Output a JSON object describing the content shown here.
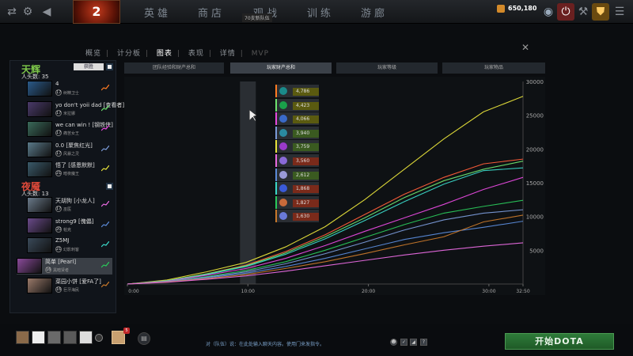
{
  "top": {
    "logo": "2",
    "nav": [
      "英雄",
      "商店",
      "观战",
      "训练",
      "游廊"
    ],
    "team_badge": "70支新队伍",
    "gold": "650,180",
    "icons": [
      "shuffle-icon",
      "gear-icon",
      "back-icon",
      "trophy-icon",
      "streaming-icon",
      "power-icon",
      "tools-icon",
      "shield-icon"
    ]
  },
  "subnav": {
    "items": [
      "概览",
      "计分板",
      "图表",
      "表现",
      "详情",
      "MVP"
    ],
    "active": "图表"
  },
  "close_symbol": "✕",
  "radiant": {
    "title": "天辉",
    "kills_label": "人头数:",
    "kills": "35",
    "win_badge": "获胜",
    "players": [
      {
        "name": "4",
        "hero": "树精卫士",
        "level": "17",
        "color": "#ff7b22",
        "portrait": "#2a5a8a"
      },
      {
        "name": "yo don't yoii dad [查看者]",
        "hero": "米拉娜",
        "level": "17",
        "color": "#6ee36e",
        "portrait": "#4a3a6a"
      },
      {
        "name": "we can win ! [钢铁侠]",
        "hero": "痛苦女王",
        "level": "17",
        "color": "#e84ae0",
        "portrait": "#3a6a5a"
      },
      {
        "name": "0.0 [聚焦红光]",
        "hero": "风暴之灵",
        "level": "17",
        "color": "#7a9ad8",
        "portrait": "#5a7a8a"
      },
      {
        "name": "悟了 [感恩默默]",
        "hero": "暗夜魔王",
        "level": "21",
        "color": "#e7e23a",
        "portrait": "#3a5a6a"
      }
    ]
  },
  "dire": {
    "title": "夜魇",
    "kills_label": "人头数:",
    "kills": "13",
    "players": [
      {
        "name": "天胡狗 [小龙人]",
        "hero": "巫医",
        "level": "17",
        "color": "#e86ae0",
        "portrait": "#6a7a8a"
      },
      {
        "name": "strong9 [傀儡]",
        "hero": "帕克",
        "level": "20",
        "color": "#5a8ad8",
        "portrait": "#6a4a8a"
      },
      {
        "name": "Z5MJ",
        "hero": "幻影刺客",
        "level": "21",
        "color": "#3ad8c8",
        "portrait": "#3a4a5a"
      },
      {
        "name": "简单 [Pearl]",
        "hero": "黑暗贤者",
        "level": "16",
        "color": "#2ac85a",
        "portrait": "#8a4a9a"
      },
      {
        "name": "菜园小饼 [爱FA了]",
        "hero": "巨牙海民",
        "level": "16",
        "color": "#c8782a",
        "portrait": "#9a7a6a"
      }
    ]
  },
  "tabs": [
    "团队经验和财产总和",
    "玩家财产总和",
    "玩家等级",
    "玩家物品"
  ],
  "active_tab": "玩家财产总和",
  "chart_data": {
    "type": "line",
    "x_ticks": [
      "0:00",
      "10:00",
      "20:00",
      "30:00",
      "32:50"
    ],
    "y_ticks": [
      5000,
      10000,
      15000,
      20000,
      25000,
      30000
    ],
    "ylim": [
      0,
      30000
    ],
    "xlim": [
      0,
      32.83
    ],
    "hover_minute": 10,
    "series": [
      {
        "color": "#e7e23a",
        "values": [
          0,
          600,
          1800,
          3200,
          5500,
          8500,
          12500,
          17000,
          21500,
          25500,
          27800
        ]
      },
      {
        "color": "#ff5e3a",
        "values": [
          0,
          500,
          1500,
          2800,
          4800,
          7300,
          10300,
          13300,
          15800,
          17800,
          18500
        ]
      },
      {
        "color": "#6ee36e",
        "values": [
          0,
          500,
          1500,
          2700,
          4600,
          7000,
          9800,
          12800,
          15300,
          17000,
          18200
        ]
      },
      {
        "color": "#3ad8c8",
        "values": [
          0,
          450,
          1400,
          2600,
          4400,
          6700,
          9400,
          12200,
          14800,
          16800,
          17200
        ]
      },
      {
        "color": "#e84ae0",
        "values": [
          0,
          400,
          1300,
          2300,
          3800,
          5700,
          7800,
          9800,
          11800,
          14000,
          15800
        ]
      },
      {
        "color": "#2ac85a",
        "values": [
          0,
          350,
          1100,
          2000,
          3300,
          5000,
          6900,
          8800,
          10500,
          11500,
          12400
        ]
      },
      {
        "color": "#7a9ad8",
        "values": [
          0,
          350,
          1000,
          1800,
          3000,
          4500,
          6200,
          8000,
          9500,
          10500,
          11000
        ]
      },
      {
        "color": "#5a8ad8",
        "values": [
          0,
          300,
          900,
          1600,
          2600,
          3800,
          5200,
          6600,
          7600,
          8400,
          9300
        ]
      },
      {
        "color": "#c8782a",
        "values": [
          0,
          300,
          800,
          1400,
          2300,
          3300,
          4500,
          5800,
          7000,
          9200,
          10200
        ]
      },
      {
        "color": "#e86ae0",
        "values": [
          0,
          250,
          700,
          1200,
          1900,
          2700,
          3500,
          4300,
          5000,
          5600,
          6100
        ]
      }
    ],
    "legend": [
      {
        "value": "4,786",
        "color": "#ff7b22",
        "icon": "#1a8a8a",
        "bg": "#5a5a10"
      },
      {
        "value": "4,423",
        "color": "#6ee36e",
        "icon": "#1aa04a",
        "bg": "#5a5a10"
      },
      {
        "value": "4,066",
        "color": "#e84ae0",
        "icon": "#3a6ac8",
        "bg": "#5a5a10"
      },
      {
        "value": "3,940",
        "color": "#7a9ad8",
        "icon": "#2a8aa0",
        "bg": "#3a5a20"
      },
      {
        "value": "3,759",
        "color": "#e7e23a",
        "icon": "#9a3ac8",
        "bg": "#3a5a20"
      },
      {
        "value": "3,560",
        "color": "#e86ae0",
        "icon": "#8a6ad8",
        "bg": "#7a2a1a"
      },
      {
        "value": "2,612",
        "color": "#5a8ad8",
        "icon": "#9a9ad8",
        "bg": "#3a5a20"
      },
      {
        "value": "1,868",
        "color": "#3ad8c8",
        "icon": "#3a5ad8",
        "bg": "#7a2a1a"
      },
      {
        "value": "1,827",
        "color": "#2ac85a",
        "icon": "#c86a3a",
        "bg": "#7a2a1a"
      },
      {
        "value": "1,630",
        "color": "#c8782a",
        "icon": "#6a7ad8",
        "bg": "#7a2a1a"
      }
    ]
  },
  "bottom": {
    "chat_hint": "对（队伍）说：在此处输入聊天内容。使用门来发指令。",
    "play_label": "开始DOTA",
    "party_badge": "5",
    "help": "?"
  }
}
